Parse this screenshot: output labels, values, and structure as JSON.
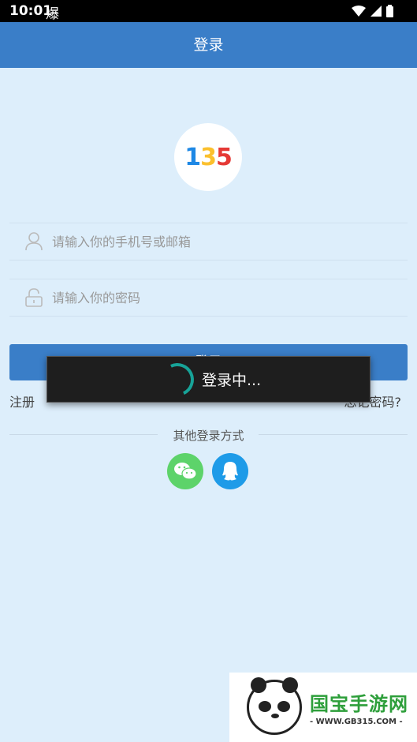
{
  "status_bar": {
    "time": "10:01",
    "app_glyph": "爆"
  },
  "app_bar": {
    "title": "登录"
  },
  "logo": {
    "text_1": "1",
    "text_2": "3",
    "text_3": "5"
  },
  "form": {
    "phone_placeholder": "请输入你的手机号或邮箱",
    "password_placeholder": "请输入你的密码",
    "login_label": "登录"
  },
  "links": {
    "register": "注册",
    "forgot": "忘记密码?"
  },
  "other_login": {
    "label": "其他登录方式"
  },
  "loading": {
    "text": "登录中..."
  },
  "watermark": {
    "title": "国宝手游网",
    "url": "- WWW.GB315.COM -"
  },
  "colors": {
    "app_bar": "#3a7ec8",
    "background": "#ddeefb",
    "wechat": "#5dd36a",
    "qq": "#1e9be8",
    "spinner": "#17a398"
  }
}
